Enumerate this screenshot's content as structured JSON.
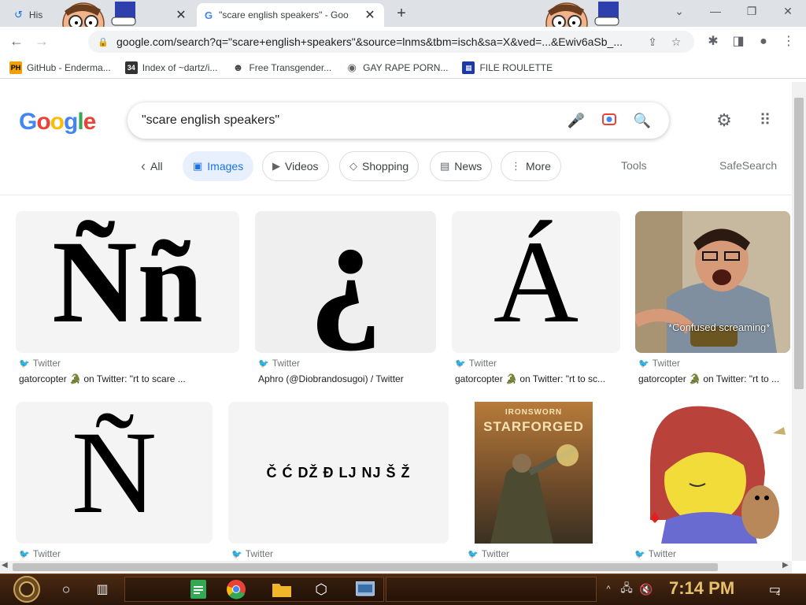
{
  "browser": {
    "tabs": [
      {
        "title": "His",
        "close": "✕"
      },
      {
        "title": "\"scare english speakers\" - Goo",
        "close": "✕"
      }
    ],
    "new_tab": "+",
    "window": {
      "minimize": "—",
      "restore": "❐",
      "close": "✕",
      "tab_search": "⌄"
    },
    "url": "google.com/search?q=\"scare+english+speakers\"&source=lnms&tbm=isch&sa=X&ved=...&Ewiv6aSb_...",
    "bookmarks": [
      {
        "label": "GitHub - Enderma...",
        "icon": "PH",
        "color": "#f0a000"
      },
      {
        "label": "Index of ~dartz/i...",
        "icon": "34",
        "color": "#333333"
      },
      {
        "label": "Free Transgender...",
        "icon": "",
        "color": "#444444"
      },
      {
        "label": "GAY RAPE PORN...",
        "icon": "",
        "color": "#5f6368"
      },
      {
        "label": "FILE ROULETTE",
        "icon": "",
        "color": "#1a3aa8"
      }
    ]
  },
  "google": {
    "logo": "Google",
    "query": "\"scare english speakers\"",
    "tabs": [
      {
        "label": "All",
        "icon": "‹"
      },
      {
        "label": "Images",
        "icon": "▣"
      },
      {
        "label": "Videos",
        "icon": "▶"
      },
      {
        "label": "Shopping",
        "icon": "◇"
      },
      {
        "label": "News",
        "icon": "▤"
      },
      {
        "label": "More",
        "icon": "⋮"
      }
    ],
    "tools": "Tools",
    "safesearch": "SafeSearch"
  },
  "results": [
    {
      "source": "Twitter",
      "caption": "gatorcopter 🐊 on Twitter: \"rt to scare ...",
      "glyph": "Ññ"
    },
    {
      "source": "Twitter",
      "caption": "Aphro (@Diobrandosugoi) / Twitter",
      "glyph": "¿"
    },
    {
      "source": "Twitter",
      "caption": "gatorcopter 🐊 on Twitter: \"rt to sc...",
      "glyph": "Á"
    },
    {
      "source": "Twitter",
      "caption": "gatorcopter 🐊 on Twitter: \"rt to ...",
      "overlay": "*Confused screaming*"
    },
    {
      "source": "Twitter",
      "caption": "",
      "glyph": "Ñ"
    },
    {
      "source": "Twitter",
      "caption": "",
      "glyph": "Č Ć DŽ Đ LJ NJ Š Ž"
    },
    {
      "source": "Twitter",
      "caption": "",
      "book_top": "IRONSWORN",
      "book_title": "STARFORGED"
    },
    {
      "source": "Twitter",
      "caption": ""
    }
  ],
  "taskbar": {
    "clock": "7:14 PM",
    "notifications": "4"
  },
  "colors": {
    "google_blue": "#4285f4",
    "google_red": "#ea4335",
    "google_yellow": "#fbbc05",
    "google_green": "#34a853",
    "accent": "#1a73e8"
  }
}
